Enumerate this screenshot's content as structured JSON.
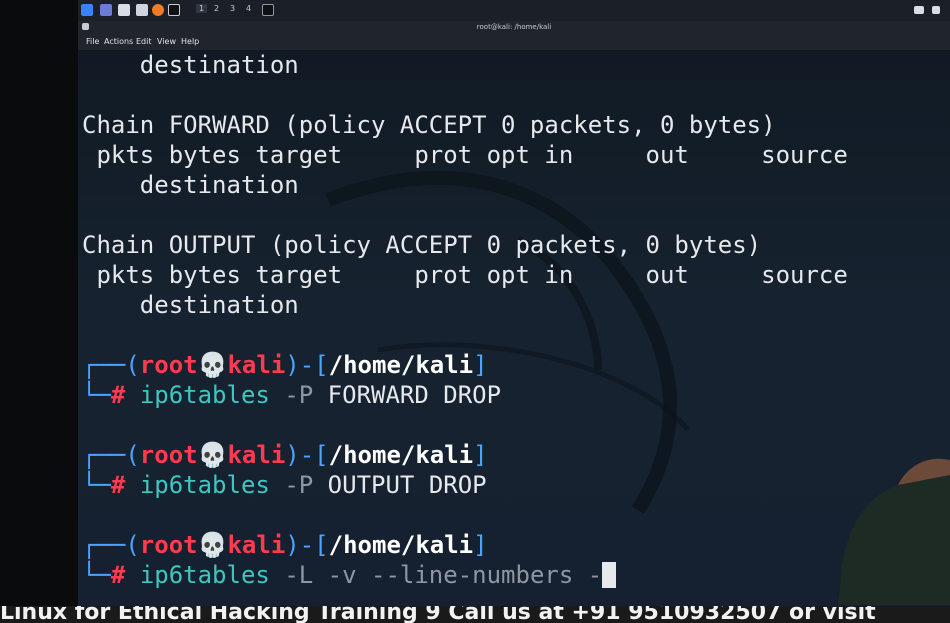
{
  "taskbar": {
    "workspaces": [
      "1",
      "2",
      "3",
      "4"
    ]
  },
  "window": {
    "title": "root@kali: /home/kali"
  },
  "menu": [
    "File",
    "Actions",
    "Edit",
    "View",
    "Help"
  ],
  "terminal": {
    "lines": [
      {
        "text": "    destination"
      },
      {
        "text": "Chain FORWARD (policy ACCEPT 0 packets, 0 bytes)"
      },
      {
        "text": " pkts bytes target     prot opt in     out     source"
      },
      {
        "text": "    destination"
      },
      {
        "text": "Chain OUTPUT (policy ACCEPT 0 packets, 0 bytes)"
      },
      {
        "text": " pkts bytes target     prot opt in     out     source"
      },
      {
        "text": "    destination"
      }
    ],
    "prompt": {
      "user": "root",
      "skull": "💀",
      "host": "kali",
      "path": "/home/kali",
      "symbol": "#"
    },
    "commands": [
      {
        "cmd": "ip6tables",
        "opt": "-P",
        "args": "FORWARD DROP"
      },
      {
        "cmd": "ip6tables",
        "opt": "-P",
        "args": "OUTPUT DROP"
      },
      {
        "cmd": "ip6tables",
        "opt": "-L -v --line-numbers -",
        "args": ""
      }
    ]
  },
  "banner": {
    "text": "Linux for Ethical Hacking Training 9 Call us at +91 9510932507 or visit"
  },
  "colors": {
    "prompt_frame": "#4aa3ff",
    "prompt_user": "#ff3b4e",
    "command": "#3ec7c0"
  }
}
